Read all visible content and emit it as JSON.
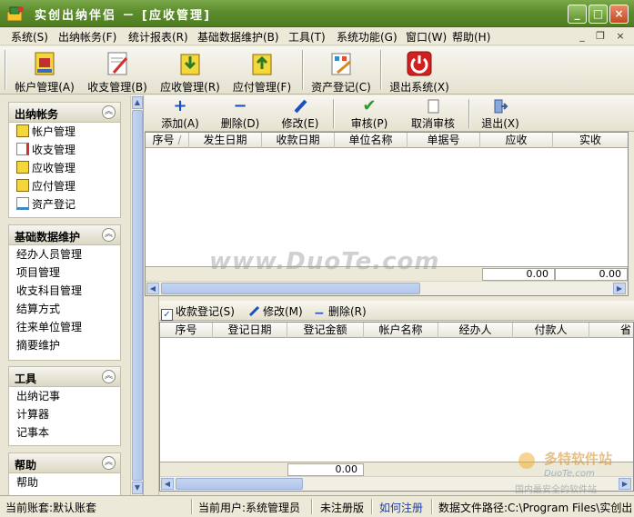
{
  "window": {
    "title": "实创出纳伴侣 － [应收管理]",
    "btn_min": "_",
    "btn_max": "□",
    "btn_close": "×"
  },
  "menu": {
    "items": [
      "系统(S)",
      "出纳帐务(F)",
      "统计报表(R)",
      "基础数据维护(B)",
      "工具(T)",
      "系统功能(G)",
      "窗口(W)",
      "帮助(H)"
    ],
    "mdi_min": "_",
    "mdi_restore": "❐",
    "mdi_close": "×"
  },
  "toolbar": {
    "items": [
      "帐户管理(A)",
      "收支管理(B)",
      "应收管理(R)",
      "应付管理(F)",
      "资产登记(C)",
      "退出系统(X)"
    ]
  },
  "sidebar": {
    "panels": [
      {
        "title": "出纳帐务",
        "collapse": "︽",
        "items": [
          "帐户管理",
          "收支管理",
          "应收管理",
          "应付管理",
          "资产登记"
        ]
      },
      {
        "title": "基础数据维护",
        "collapse": "︽",
        "items": [
          "经办人员管理",
          "项目管理",
          "收支科目管理",
          "结算方式",
          "往来单位管理",
          "摘要维护"
        ]
      },
      {
        "title": "工具",
        "collapse": "︽",
        "items": [
          "出纳记事",
          "计算器",
          "记事本"
        ]
      },
      {
        "title": "帮助",
        "collapse": "︽",
        "items": [
          "帮助"
        ]
      }
    ],
    "scroll_up": "▲",
    "scroll_down": "▼"
  },
  "subtoolbar": {
    "items": [
      "添加(A)",
      "删除(D)",
      "修改(E)",
      "审核(P)",
      "取消审核",
      "退出(X)"
    ]
  },
  "upper_grid": {
    "columns": [
      "序号",
      "发生日期",
      "收款日期",
      "单位名称",
      "单据号",
      "应收",
      "实收"
    ],
    "sort_marker": "/",
    "totals": [
      "0.00",
      "0.00"
    ]
  },
  "lower_bar": {
    "items": [
      "收款登记(S)",
      "修改(M)",
      "删除(R)"
    ]
  },
  "lower_grid": {
    "columns": [
      "序号",
      "登记日期",
      "登记金额",
      "帐户名称",
      "经办人",
      "付款人",
      "省"
    ],
    "totals": [
      "0.00"
    ]
  },
  "scroll": {
    "left": "◀",
    "right": "▶"
  },
  "statusbar": {
    "account": "当前账套:默认账套",
    "user": "当前用户:系统管理员",
    "registration": "未注册版",
    "register_link": "如何注册",
    "data_path": "数据文件路径:C:\\Program Files\\实创出"
  },
  "watermark": {
    "main": "www.DuoTe.com",
    "brand": "多特软件站",
    "brand_en": "DuoTe.com",
    "brand_sub": "国内最安全的软件站"
  },
  "colors": {
    "title_green": "#5c8c2c",
    "link_blue": "#1a3fb0"
  }
}
